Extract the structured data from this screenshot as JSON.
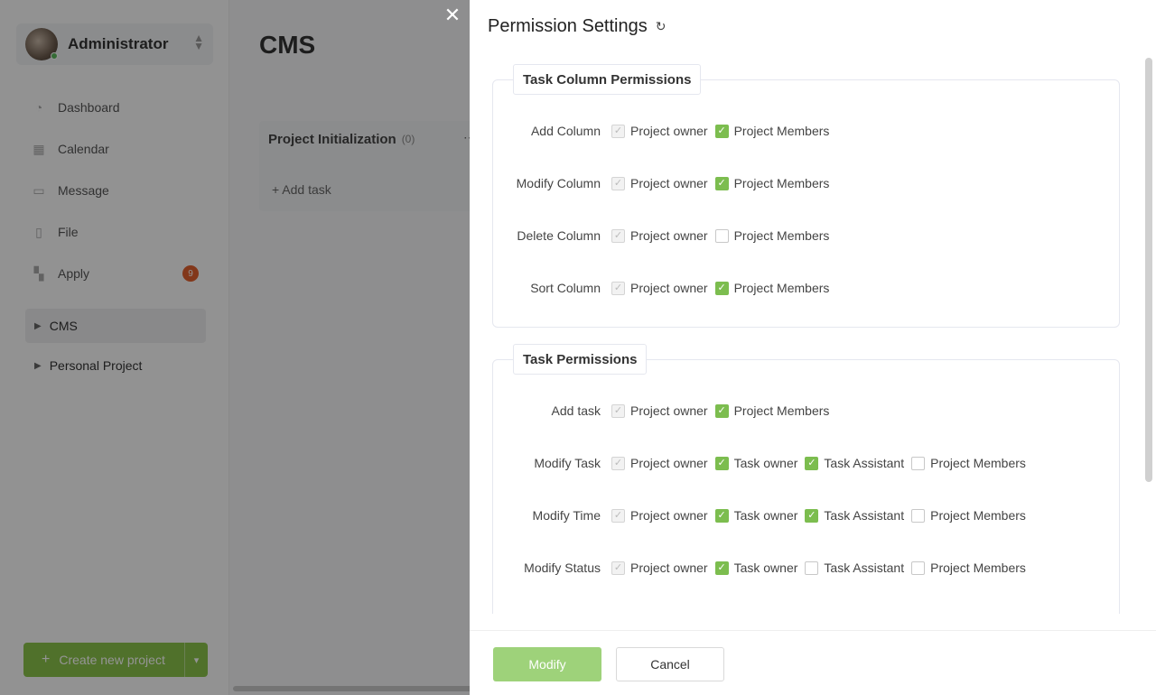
{
  "user": {
    "name": "Administrator"
  },
  "nav": [
    {
      "label": "Dashboard",
      "icon": "dashboard-icon"
    },
    {
      "label": "Calendar",
      "icon": "calendar-icon"
    },
    {
      "label": "Message",
      "icon": "message-icon"
    },
    {
      "label": "File",
      "icon": "file-icon"
    },
    {
      "label": "Apply",
      "icon": "apply-icon",
      "badge": "9"
    }
  ],
  "projects": [
    {
      "label": "CMS",
      "active": true
    },
    {
      "label": "Personal Project",
      "active": false
    }
  ],
  "create_button": {
    "label": "Create new project"
  },
  "main": {
    "title": "CMS",
    "column": {
      "title": "Project Initialization",
      "count": "(0)",
      "add_task": "Add task"
    }
  },
  "drawer": {
    "title": "Permission Settings",
    "sections": [
      {
        "title": "Task Column Permissions",
        "rows": [
          {
            "label": "Add Column",
            "options": [
              {
                "label": "Project owner",
                "state": "disabled"
              },
              {
                "label": "Project Members",
                "state": "checked"
              }
            ]
          },
          {
            "label": "Modify Column",
            "options": [
              {
                "label": "Project owner",
                "state": "disabled"
              },
              {
                "label": "Project Members",
                "state": "checked"
              }
            ]
          },
          {
            "label": "Delete Column",
            "options": [
              {
                "label": "Project owner",
                "state": "disabled"
              },
              {
                "label": "Project Members",
                "state": "unchecked"
              }
            ]
          },
          {
            "label": "Sort Column",
            "options": [
              {
                "label": "Project owner",
                "state": "disabled"
              },
              {
                "label": "Project Members",
                "state": "checked"
              }
            ]
          }
        ]
      },
      {
        "title": "Task Permissions",
        "rows": [
          {
            "label": "Add task",
            "options": [
              {
                "label": "Project owner",
                "state": "disabled"
              },
              {
                "label": "Project Members",
                "state": "checked"
              }
            ]
          },
          {
            "label": "Modify Task",
            "options": [
              {
                "label": "Project owner",
                "state": "disabled"
              },
              {
                "label": "Task owner",
                "state": "checked"
              },
              {
                "label": "Task Assistant",
                "state": "checked"
              },
              {
                "label": "Project Members",
                "state": "unchecked"
              }
            ]
          },
          {
            "label": "Modify Time",
            "options": [
              {
                "label": "Project owner",
                "state": "disabled"
              },
              {
                "label": "Task owner",
                "state": "checked"
              },
              {
                "label": "Task Assistant",
                "state": "checked"
              },
              {
                "label": "Project Members",
                "state": "unchecked"
              }
            ]
          },
          {
            "label": "Modify Status",
            "options": [
              {
                "label": "Project owner",
                "state": "disabled"
              },
              {
                "label": "Task owner",
                "state": "checked"
              },
              {
                "label": "Task Assistant",
                "state": "unchecked"
              },
              {
                "label": "Project Members",
                "state": "unchecked"
              }
            ]
          }
        ]
      }
    ],
    "buttons": {
      "modify": "Modify",
      "cancel": "Cancel"
    }
  },
  "colors": {
    "accent": "#8bc34a",
    "checkbox": "#7cbd4f",
    "badge": "#e0602e"
  }
}
